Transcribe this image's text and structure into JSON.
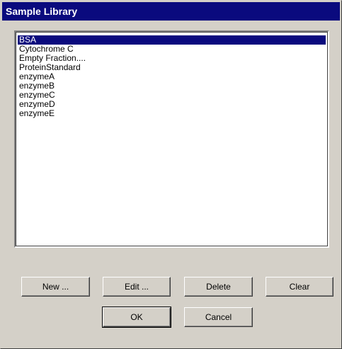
{
  "window": {
    "title": "Sample Library"
  },
  "samples": {
    "items": [
      {
        "label": "BSA",
        "selected": true
      },
      {
        "label": "Cytochrome C",
        "selected": false
      },
      {
        "label": "Empty Fraction....",
        "selected": false
      },
      {
        "label": "ProteinStandard",
        "selected": false
      },
      {
        "label": "enzymeA",
        "selected": false
      },
      {
        "label": "enzymeB",
        "selected": false
      },
      {
        "label": "enzymeC",
        "selected": false
      },
      {
        "label": "enzymeD",
        "selected": false
      },
      {
        "label": "enzymeE",
        "selected": false
      }
    ]
  },
  "buttons": {
    "new_label": "New ...",
    "edit_label": "Edit ...",
    "delete_label": "Delete",
    "clear_label": "Clear",
    "ok_label": "OK",
    "cancel_label": "Cancel"
  },
  "colors": {
    "dialog_face": "#d4d0c8",
    "title_bar": "#0a0a7e",
    "selection": "#0a0a7e"
  }
}
